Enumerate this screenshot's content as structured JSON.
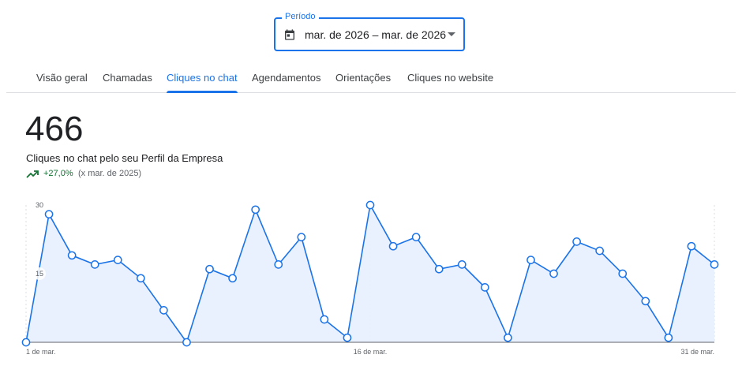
{
  "period": {
    "label": "Período",
    "value": "mar. de 2026 – mar. de 2026",
    "icon": "calendar-icon",
    "dropdown_icon": "arrow-drop-down-icon"
  },
  "tabs": [
    {
      "label": "Visão geral",
      "active": false
    },
    {
      "label": "Chamadas",
      "active": false
    },
    {
      "label": "Cliques no chat",
      "active": true
    },
    {
      "label": "Agendamentos",
      "active": false
    },
    {
      "label": "Orientações",
      "active": false
    },
    {
      "label": "Cliques no website",
      "active": false
    }
  ],
  "metric": {
    "value": "466",
    "label": "Cliques no chat pelo seu Perfil da Empresa",
    "change": "+27,0%",
    "comparison": "(x mar. de 2025)",
    "change_icon": "trending-up-icon"
  },
  "colors": {
    "accent": "#1a73e8",
    "positive": "#137333",
    "area_fill": "#e8f0fe"
  },
  "chart_data": {
    "type": "area",
    "x": [
      1,
      2,
      3,
      4,
      5,
      6,
      7,
      8,
      9,
      10,
      11,
      12,
      13,
      14,
      15,
      16,
      17,
      18,
      19,
      20,
      21,
      22,
      23,
      24,
      25,
      26,
      27,
      28,
      29,
      30,
      31
    ],
    "x_tick_labels": [
      "1 de mar.",
      "16 de mar.",
      "31 de mar."
    ],
    "x_tick_days": [
      1,
      16,
      31
    ],
    "series": [
      {
        "values": [
          0,
          28,
          19,
          17,
          18,
          14,
          7,
          0,
          16,
          14,
          29,
          17,
          23,
          5,
          1,
          30,
          21,
          23,
          16,
          17,
          12,
          1,
          18,
          15,
          22,
          20,
          15,
          9,
          1,
          21,
          17
        ]
      }
    ],
    "ylim": [
      0,
      30
    ],
    "y_ticks": [
      15,
      30
    ],
    "grid": "vertical dashed at x ticks"
  }
}
